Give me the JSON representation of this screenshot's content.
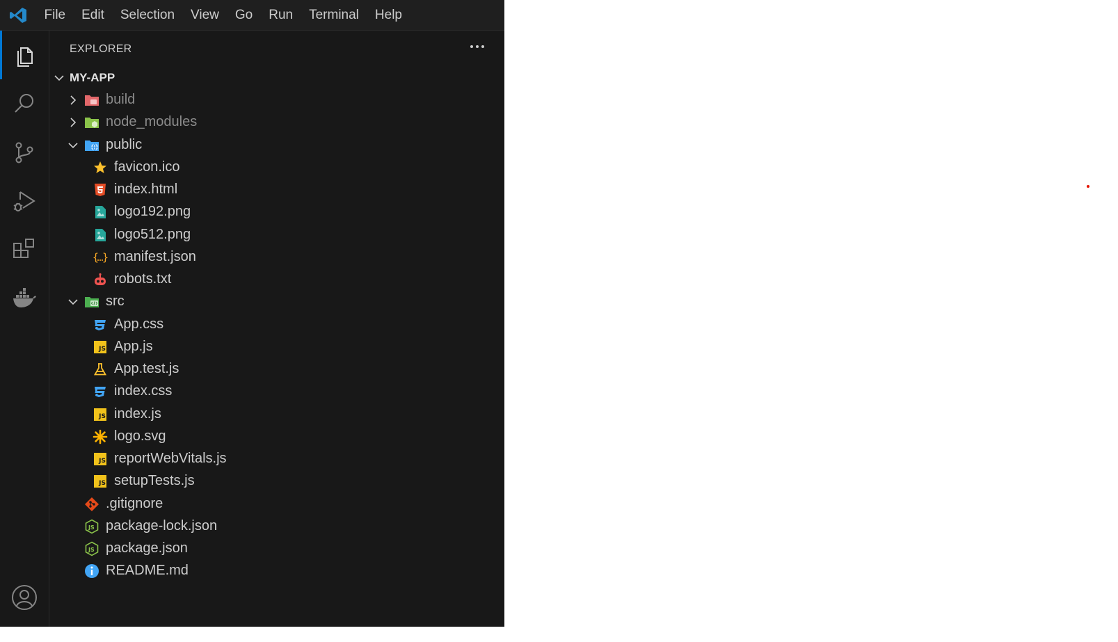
{
  "menu": [
    "File",
    "Edit",
    "Selection",
    "View",
    "Go",
    "Run",
    "Terminal",
    "Help"
  ],
  "activity_bar": [
    {
      "name": "explorer-icon",
      "active": true
    },
    {
      "name": "search-icon",
      "active": false
    },
    {
      "name": "source-control-icon",
      "active": false
    },
    {
      "name": "run-debug-icon",
      "active": false
    },
    {
      "name": "extensions-icon",
      "active": false
    },
    {
      "name": "docker-icon",
      "active": false
    }
  ],
  "account_icon": "account-icon",
  "explorer": {
    "title": "EXPLORER",
    "more_actions": "···",
    "root": "MY-APP",
    "items": [
      {
        "label": "build",
        "depth": 1,
        "type": "folder",
        "expanded": false,
        "icon": "folder-build-icon",
        "dim": true
      },
      {
        "label": "node_modules",
        "depth": 1,
        "type": "folder",
        "expanded": false,
        "icon": "folder-node-icon",
        "dim": true
      },
      {
        "label": "public",
        "depth": 1,
        "type": "folder",
        "expanded": true,
        "icon": "folder-public-icon",
        "dim": false
      },
      {
        "label": "favicon.ico",
        "depth": 2,
        "type": "file",
        "icon": "favicon-icon"
      },
      {
        "label": "index.html",
        "depth": 2,
        "type": "file",
        "icon": "html-icon"
      },
      {
        "label": "logo192.png",
        "depth": 2,
        "type": "file",
        "icon": "image-icon"
      },
      {
        "label": "logo512.png",
        "depth": 2,
        "type": "file",
        "icon": "image-icon"
      },
      {
        "label": "manifest.json",
        "depth": 2,
        "type": "file",
        "icon": "json-icon"
      },
      {
        "label": "robots.txt",
        "depth": 2,
        "type": "file",
        "icon": "robot-icon"
      },
      {
        "label": "src",
        "depth": 1,
        "type": "folder",
        "expanded": true,
        "icon": "folder-src-icon",
        "dim": false
      },
      {
        "label": "App.css",
        "depth": 2,
        "type": "file",
        "icon": "css-icon"
      },
      {
        "label": "App.js",
        "depth": 2,
        "type": "file",
        "icon": "js-icon"
      },
      {
        "label": "App.test.js",
        "depth": 2,
        "type": "file",
        "icon": "test-flask-icon"
      },
      {
        "label": "index.css",
        "depth": 2,
        "type": "file",
        "icon": "css-icon"
      },
      {
        "label": "index.js",
        "depth": 2,
        "type": "file",
        "icon": "js-icon"
      },
      {
        "label": "logo.svg",
        "depth": 2,
        "type": "file",
        "icon": "svg-icon"
      },
      {
        "label": "reportWebVitals.js",
        "depth": 2,
        "type": "file",
        "icon": "js-icon"
      },
      {
        "label": "setupTests.js",
        "depth": 2,
        "type": "file",
        "icon": "js-icon"
      },
      {
        "label": ".gitignore",
        "depth": 1,
        "type": "file",
        "icon": "git-icon"
      },
      {
        "label": "package-lock.json",
        "depth": 1,
        "type": "file",
        "icon": "nodejs-icon"
      },
      {
        "label": "package.json",
        "depth": 1,
        "type": "file",
        "icon": "nodejs-icon"
      },
      {
        "label": "README.md",
        "depth": 1,
        "type": "file",
        "icon": "info-icon"
      }
    ]
  },
  "colors": {
    "editor_bg": "#181818",
    "accent": "#0078d4",
    "js_yellow": "#f1c21b",
    "css_blue": "#42a5f5",
    "html_red": "#e44d26"
  }
}
